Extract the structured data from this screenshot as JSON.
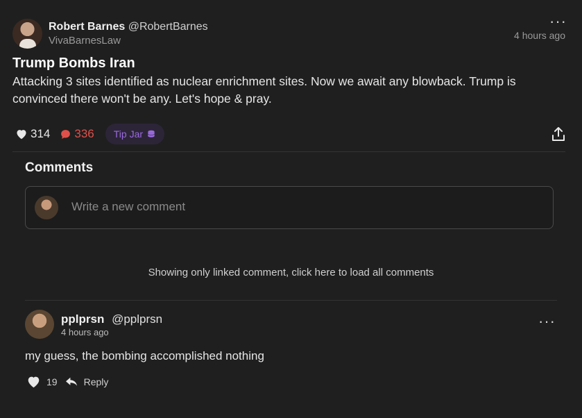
{
  "post": {
    "author_name": "Robert Barnes",
    "author_handle": "@RobertBarnes",
    "publication": "VivaBarnesLaw",
    "time": "4 hours ago",
    "title": "Trump Bombs Iran",
    "body": "Attacking 3 sites identified as nuclear enrichment sites. Now we await any blowback. Trump is convinced there won't be any. Let's hope & pray.",
    "likes": "314",
    "comments": "336",
    "tip_jar_label": "Tip Jar"
  },
  "comments_section": {
    "heading": "Comments",
    "input_placeholder": "Write a new comment",
    "load_all_text": "Showing only linked comment, click here to load all comments"
  },
  "comment": {
    "author_name": "pplprsn",
    "author_handle": "@pplprsn",
    "time": "4 hours ago",
    "text": "my guess, the bombing accomplished nothing",
    "likes": "19",
    "reply_label": "Reply"
  },
  "colors": {
    "background": "#1f1f1f",
    "comment_count": "#e0504a",
    "tip_jar_text": "#9b6be0",
    "tip_jar_bg": "#2c2538"
  },
  "icons": {
    "like": "heart-icon",
    "comment": "speech-bubble-icon",
    "tip": "coin-stack-icon",
    "share": "share-upload-icon",
    "menu": "more-horizontal-icon",
    "reply": "reply-arrow-icon"
  }
}
